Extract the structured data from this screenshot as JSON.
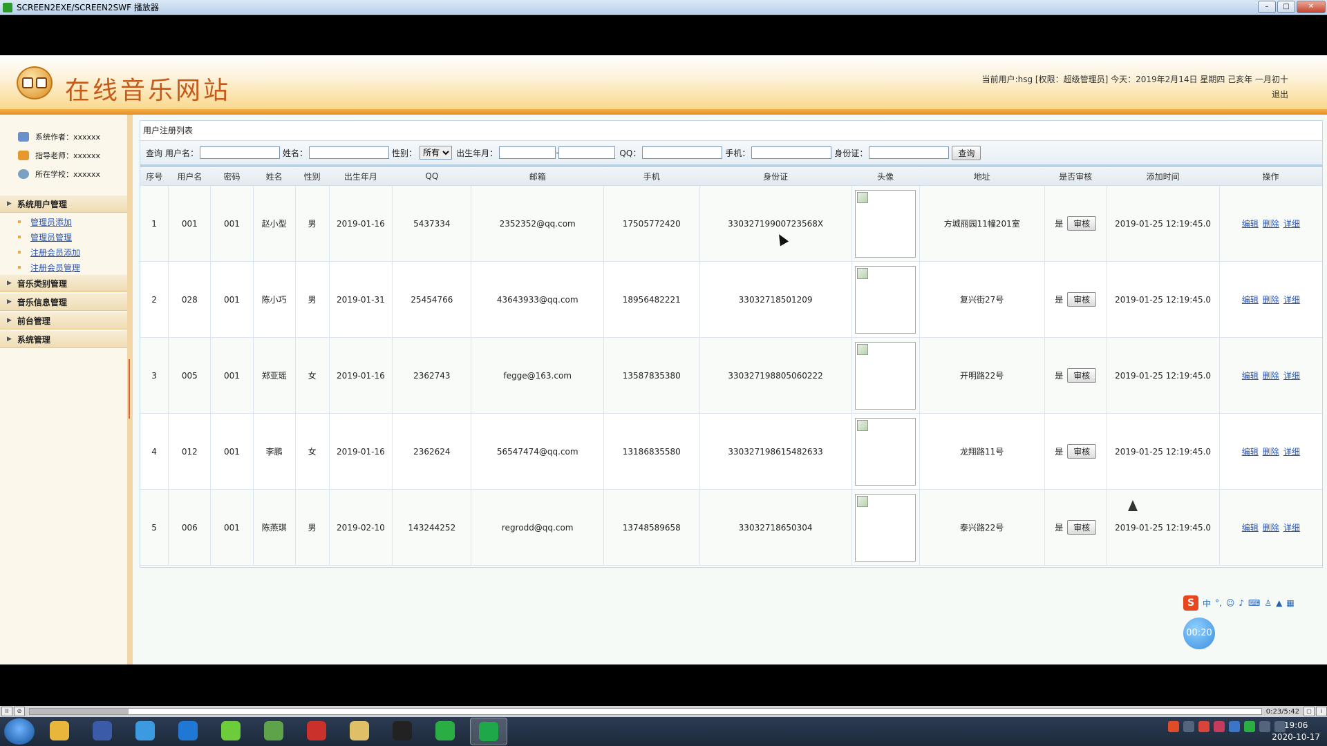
{
  "window": {
    "title": "SCREEN2EXE/SCREEN2SWF 播放器",
    "btn_min": "–",
    "btn_max": "□",
    "btn_close": "✕"
  },
  "header": {
    "site_title": "在线音乐网站",
    "user_info": "当前用户:hsg [权限：超级管理员] 今天：2019年2月14日 星期四 己亥年 一月初十",
    "logout": "退出"
  },
  "sidebar": {
    "info": [
      {
        "label": "系统作者：xxxxxx",
        "icon": "users-icon",
        "color": "#6a8fc9"
      },
      {
        "label": "指导老师：xxxxxx",
        "icon": "teacher-icon",
        "color": "#e69a2d"
      },
      {
        "label": "所在学校：xxxxxx",
        "icon": "globe-icon",
        "color": "#7aa0c4"
      }
    ],
    "categories": [
      {
        "label": "系统用户管理",
        "items": [
          "管理员添加",
          "管理员管理",
          "注册会员添加",
          "注册会员管理"
        ]
      },
      {
        "label": "音乐类别管理",
        "items": []
      },
      {
        "label": "音乐信息管理",
        "items": []
      },
      {
        "label": "前台管理",
        "items": []
      },
      {
        "label": "系统管理",
        "items": []
      }
    ]
  },
  "panel": {
    "title": "用户注册列表",
    "search": {
      "query_label": "查询",
      "username_label": "用户名：",
      "name_label": "姓名：",
      "gender_label": "性别：",
      "gender_value": "所有",
      "birth_label": "出生年月：",
      "birth_sep": "-",
      "qq_label": "QQ：",
      "phone_label": "手机：",
      "idcard_label": "身份证：",
      "submit": "查询"
    },
    "columns": [
      "序号",
      "用户名",
      "密码",
      "姓名",
      "性别",
      "出生年月",
      "QQ",
      "邮箱",
      "手机",
      "身份证",
      "头像",
      "地址",
      "是否审核",
      "添加时间",
      "操作"
    ],
    "rows": [
      {
        "no": "1",
        "username": "001",
        "password": "001",
        "name": "赵小型",
        "gender": "男",
        "birth": "2019-01-16",
        "qq": "5437334",
        "email": "2352352@qq.com",
        "phone": "17505772420",
        "idcard": "33032719900723568X",
        "address": "方城丽园11幢201室",
        "audited": "是",
        "added": "2019-01-25 12:19:45.0"
      },
      {
        "no": "2",
        "username": "028",
        "password": "001",
        "name": "陈小巧",
        "gender": "男",
        "birth": "2019-01-31",
        "qq": "25454766",
        "email": "43643933@qq.com",
        "phone": "18956482221",
        "idcard": "33032718501209",
        "address": "复兴街27号",
        "audited": "是",
        "added": "2019-01-25 12:19:45.0"
      },
      {
        "no": "3",
        "username": "005",
        "password": "001",
        "name": "郑亚瑶",
        "gender": "女",
        "birth": "2019-01-16",
        "qq": "2362743",
        "email": "fegge@163.com",
        "phone": "13587835380",
        "idcard": "330327198805060222",
        "address": "开明路22号",
        "audited": "是",
        "added": "2019-01-25 12:19:45.0"
      },
      {
        "no": "4",
        "username": "012",
        "password": "001",
        "name": "李鹏",
        "gender": "女",
        "birth": "2019-01-16",
        "qq": "2362624",
        "email": "56547474@qq.com",
        "phone": "13186835580",
        "idcard": "330327198615482633",
        "address": "龙翔路11号",
        "audited": "是",
        "added": "2019-01-25 12:19:45.0"
      },
      {
        "no": "5",
        "username": "006",
        "password": "001",
        "name": "陈燕琪",
        "gender": "男",
        "birth": "2019-02-10",
        "qq": "143244252",
        "email": "regrodd@qq.com",
        "phone": "13748589658",
        "idcard": "33032718650304",
        "address": "泰兴路22号",
        "audited": "是",
        "added": "2019-01-25 12:19:45.0"
      }
    ],
    "review_btn": "审核",
    "ops": [
      "编辑",
      "删除",
      "详细"
    ]
  },
  "overlay": {
    "ime_logo": "S",
    "ime_mode": "中",
    "timer": "00:20"
  },
  "player": {
    "btn_pause": "II",
    "btn_rewind": "⊘",
    "time": "0:23/5:42",
    "progress": 0.08
  },
  "taskbar": {
    "time": "19:06",
    "date": "2020-10-17",
    "apps": [
      "chrome-icon",
      "sublime-icon",
      "photos-icon",
      "browser-icon",
      "music-icon",
      "spreadsheet-icon",
      "flash-icon",
      "folder-icon",
      "qq-icon",
      "wechat-icon",
      "player-icon"
    ]
  }
}
